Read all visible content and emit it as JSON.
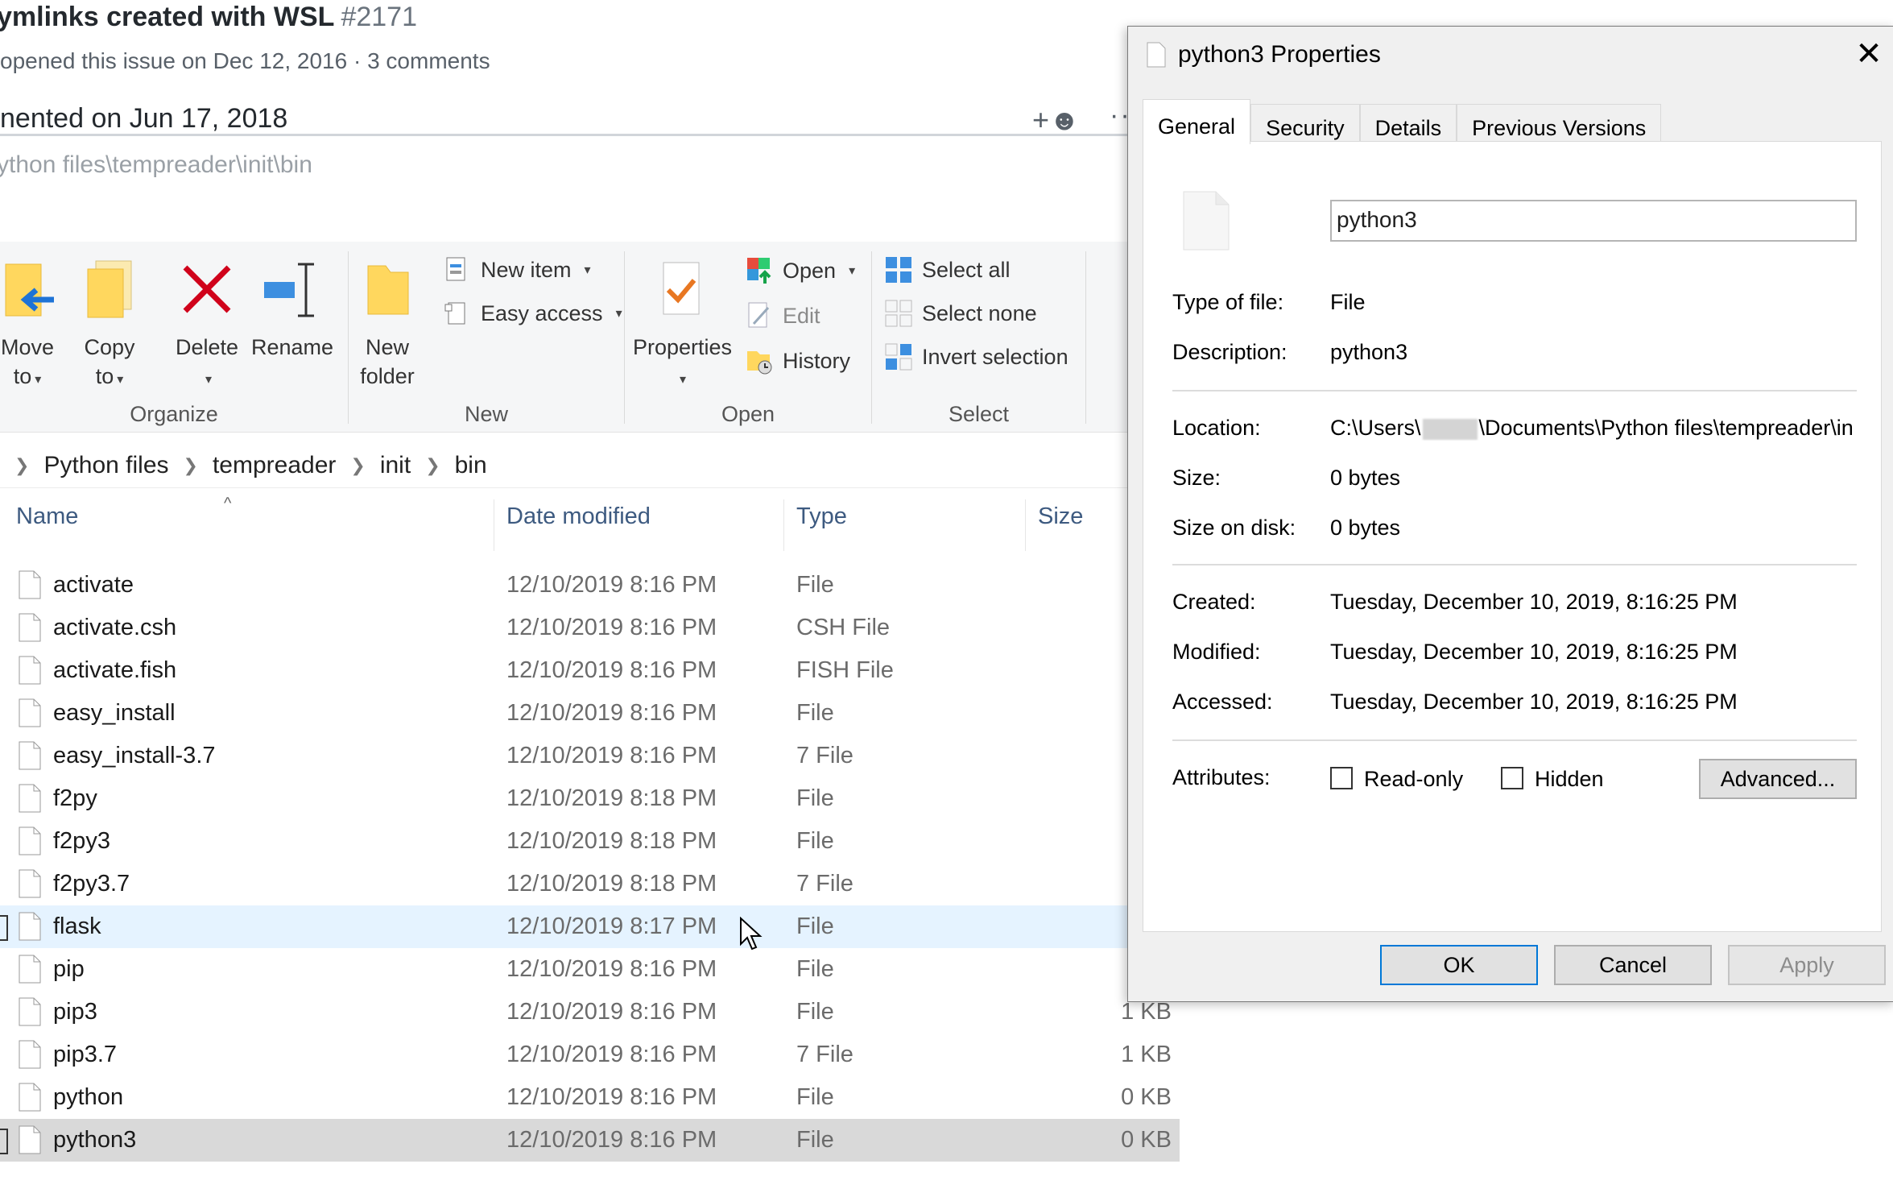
{
  "github": {
    "title": "ymlinks created with WSL",
    "issue_number": "#2171",
    "meta": "opened this issue on Dec 12, 2016 · 3 comments",
    "comment_header": "nented on Jun 17, 2018",
    "react_icon": "add-reaction-icon",
    "more_label": "··",
    "path_fragment": "ython files\\tempreader\\init\\bin"
  },
  "ribbon": {
    "organize": {
      "label": "Organize",
      "move_to": [
        "Move",
        "to"
      ],
      "copy_to": [
        "Copy",
        "to"
      ],
      "delete": "Delete",
      "rename": "Rename"
    },
    "new": {
      "label": "New",
      "new_folder": [
        "New",
        "folder"
      ],
      "new_item": "New item",
      "easy_access": "Easy access"
    },
    "open": {
      "label": "Open",
      "properties": "Properties",
      "open": "Open",
      "edit": "Edit",
      "history": "History"
    },
    "select": {
      "label": "Select",
      "select_all": "Select all",
      "select_none": "Select none",
      "invert": "Invert selection"
    }
  },
  "breadcrumb": [
    "Python files",
    "tempreader",
    "init",
    "bin"
  ],
  "columns": {
    "name": "Name",
    "date": "Date modified",
    "type": "Type",
    "size": "Size"
  },
  "files": [
    {
      "name": "activate",
      "date": "12/10/2019 8:16 PM",
      "type": "File",
      "size": ""
    },
    {
      "name": "activate.csh",
      "date": "12/10/2019 8:16 PM",
      "type": "CSH File",
      "size": ""
    },
    {
      "name": "activate.fish",
      "date": "12/10/2019 8:16 PM",
      "type": "FISH File",
      "size": ""
    },
    {
      "name": "easy_install",
      "date": "12/10/2019 8:16 PM",
      "type": "File",
      "size": ""
    },
    {
      "name": "easy_install-3.7",
      "date": "12/10/2019 8:16 PM",
      "type": "7 File",
      "size": ""
    },
    {
      "name": "f2py",
      "date": "12/10/2019 8:18 PM",
      "type": "File",
      "size": ""
    },
    {
      "name": "f2py3",
      "date": "12/10/2019 8:18 PM",
      "type": "File",
      "size": ""
    },
    {
      "name": "f2py3.7",
      "date": "12/10/2019 8:18 PM",
      "type": "7 File",
      "size": ""
    },
    {
      "name": "flask",
      "date": "12/10/2019 8:17 PM",
      "type": "File",
      "size": "",
      "state": "hover"
    },
    {
      "name": "pip",
      "date": "12/10/2019 8:16 PM",
      "type": "File",
      "size": ""
    },
    {
      "name": "pip3",
      "date": "12/10/2019 8:16 PM",
      "type": "File",
      "size": "1 KB"
    },
    {
      "name": "pip3.7",
      "date": "12/10/2019 8:16 PM",
      "type": "7 File",
      "size": "1 KB"
    },
    {
      "name": "python",
      "date": "12/10/2019 8:16 PM",
      "type": "File",
      "size": "0 KB"
    },
    {
      "name": "python3",
      "date": "12/10/2019 8:16 PM",
      "type": "File",
      "size": "0 KB",
      "state": "selected"
    }
  ],
  "dialog": {
    "title": "python3 Properties",
    "close": "✕",
    "tabs": [
      "General",
      "Security",
      "Details",
      "Previous Versions"
    ],
    "active_tab": "General",
    "file_name": "python3",
    "type_of_file_label": "Type of file:",
    "type_of_file": "File",
    "description_label": "Description:",
    "description": "python3",
    "location_label": "Location:",
    "location_prefix": "C:\\Users\\",
    "location_suffix": "\\Documents\\Python files\\tempreader\\in",
    "size_label": "Size:",
    "size": "0 bytes",
    "size_on_disk_label": "Size on disk:",
    "size_on_disk": "0 bytes",
    "created_label": "Created:",
    "created": "Tuesday, December 10, 2019, 8:16:25 PM",
    "modified_label": "Modified:",
    "modified": "Tuesday, December 10, 2019, 8:16:25 PM",
    "accessed_label": "Accessed:",
    "accessed": "Tuesday, December 10, 2019, 8:16:25 PM",
    "attributes_label": "Attributes:",
    "readonly_label": "Read-only",
    "hidden_label": "Hidden",
    "advanced_label": "Advanced...",
    "ok_label": "OK",
    "cancel_label": "Cancel",
    "apply_label": "Apply"
  },
  "colors": {
    "hover_row": "#e5f3ff",
    "selected_row": "#d9d9d9",
    "accent": "#0078d7",
    "delete_red": "#d0021b"
  }
}
